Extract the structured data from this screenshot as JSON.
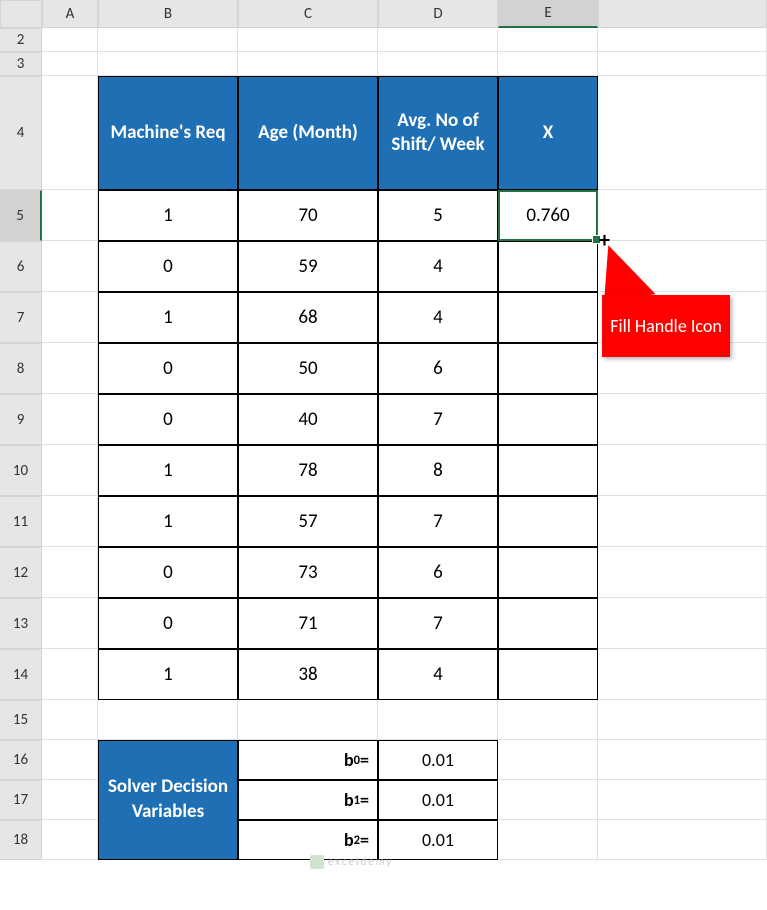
{
  "col_headers": [
    "A",
    "B",
    "C",
    "D",
    "E"
  ],
  "row_headers": [
    "2",
    "3",
    "4",
    "5",
    "6",
    "7",
    "8",
    "9",
    "10",
    "11",
    "12",
    "13",
    "14",
    "15",
    "16",
    "17",
    "18"
  ],
  "table": {
    "headers": [
      "Machine's Req",
      "Age (Month)",
      "Avg. No of Shift/ Week",
      "X"
    ],
    "rows": [
      {
        "req": "1",
        "age": "70",
        "shift": "5",
        "x": "0.760"
      },
      {
        "req": "0",
        "age": "59",
        "shift": "4",
        "x": ""
      },
      {
        "req": "1",
        "age": "68",
        "shift": "4",
        "x": ""
      },
      {
        "req": "0",
        "age": "50",
        "shift": "6",
        "x": ""
      },
      {
        "req": "0",
        "age": "40",
        "shift": "7",
        "x": ""
      },
      {
        "req": "1",
        "age": "78",
        "shift": "8",
        "x": ""
      },
      {
        "req": "1",
        "age": "57",
        "shift": "7",
        "x": ""
      },
      {
        "req": "0",
        "age": "73",
        "shift": "6",
        "x": ""
      },
      {
        "req": "0",
        "age": "71",
        "shift": "7",
        "x": ""
      },
      {
        "req": "1",
        "age": "38",
        "shift": "4",
        "x": ""
      }
    ]
  },
  "solver": {
    "title": "Solver Decision Variables",
    "items": [
      {
        "label_pre": "b",
        "label_sub": "0",
        "label_post": " =",
        "val": "0.01"
      },
      {
        "label_pre": "b",
        "label_sub": "1",
        "label_post": " =",
        "val": "0.01"
      },
      {
        "label_pre": "b",
        "label_sub": "2",
        "label_post": " =",
        "val": "0.01"
      }
    ]
  },
  "callout": "Fill Handle Icon",
  "watermark": "exceldemy"
}
